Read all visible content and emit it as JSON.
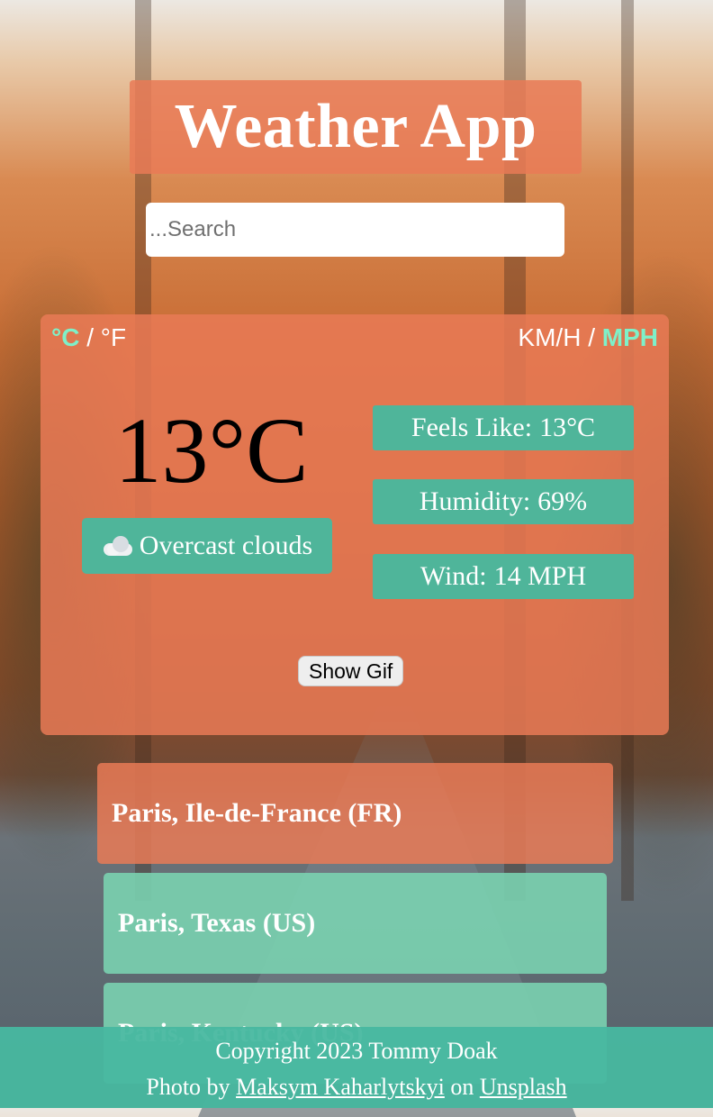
{
  "header": {
    "title": "Weather App"
  },
  "search": {
    "placeholder": "...Search"
  },
  "units": {
    "temp_celsius": "°C",
    "separator": "/",
    "temp_fahrenheit": "°F",
    "speed_kmh": "KM/H",
    "speed_mph": "MPH",
    "active_temp": "°C",
    "active_speed": "MPH"
  },
  "weather": {
    "temperature": "13°C",
    "condition": "Overcast clouds",
    "condition_icon": "cloud-icon",
    "feels_like_label": "Feels Like:",
    "feels_like_value": "13°C",
    "humidity_label": "Humidity:",
    "humidity_value": "69%",
    "wind_label": "Wind:",
    "wind_value": "14 MPH"
  },
  "gif_button": {
    "label": "Show Gif"
  },
  "results": [
    {
      "label": "Paris, Ile-de-France (FR)"
    },
    {
      "label": "Paris, Texas (US)"
    },
    {
      "label": "Paris, Kentucky (US)"
    }
  ],
  "footer": {
    "copyright": "Copyright 2023 Tommy Doak",
    "photo_by": "Photo by",
    "photographer": "Maksym Kaharlytskyi",
    "on": "on",
    "source": "Unsplash"
  },
  "colors": {
    "card": "#e97a56",
    "accent": "#4fb59a",
    "active_unit": "#7ef0c8",
    "result_alt": "#7ad2b0",
    "footer": "#48b8a0"
  }
}
